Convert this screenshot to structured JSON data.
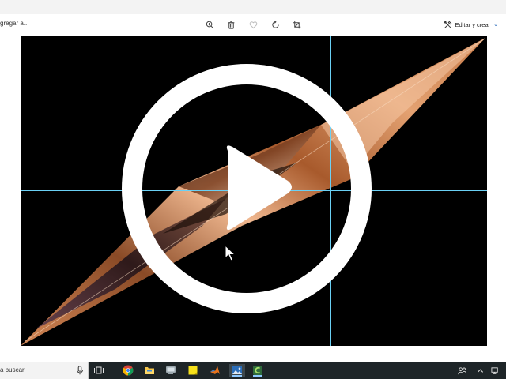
{
  "toolbar": {
    "add_to_label": "gregar a...",
    "edit_create_label": "Editar y crear",
    "icons": [
      "zoom-in-icon",
      "delete-icon",
      "favorite-icon",
      "rotate-icon",
      "crop-icon"
    ]
  },
  "taskbar": {
    "search_placeholder": "a buscar",
    "apps": [
      "task-view",
      "chrome",
      "file-explorer",
      "virtual-machine",
      "sticky-notes",
      "matlab",
      "photos",
      "camtasia"
    ]
  },
  "colors": {
    "grid_line": "#6ad0f4",
    "taskbar_bg": "#1e2528",
    "accent": "#1a5fb4"
  }
}
